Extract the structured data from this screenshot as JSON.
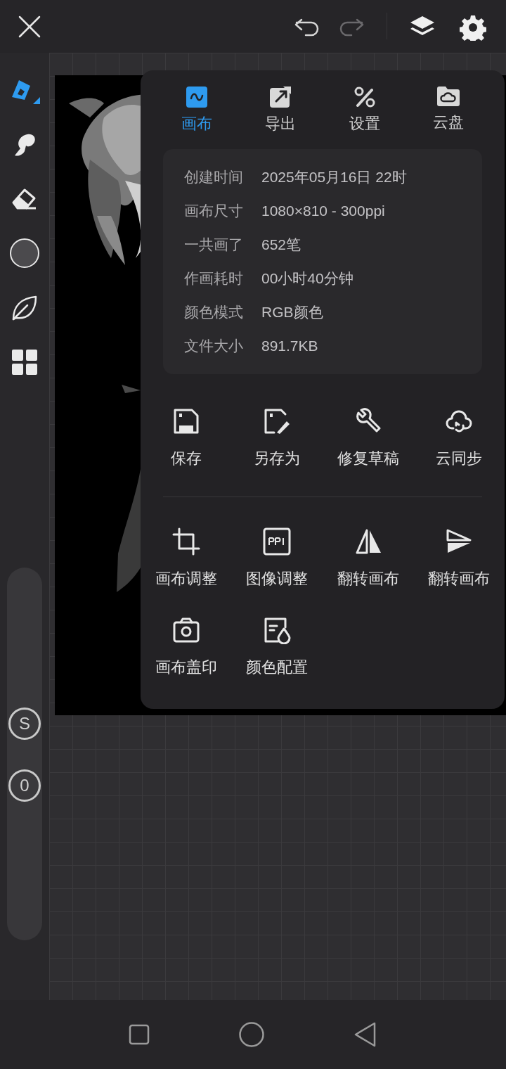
{
  "top_bar": {
    "redo_disabled": true
  },
  "toolbar": {
    "tools": [
      {
        "kind": "pen",
        "selected": true
      },
      {
        "kind": "smudge",
        "selected": false
      },
      {
        "kind": "eraser",
        "selected": false
      },
      {
        "kind": "color",
        "selected": false,
        "color": "#4b4a4d"
      },
      {
        "kind": "leaf",
        "selected": false
      },
      {
        "kind": "grid",
        "selected": false
      }
    ],
    "sliders": [
      {
        "label": "S",
        "level": 0.09
      },
      {
        "label": "0",
        "level": 0.9
      }
    ]
  },
  "panel": {
    "tabs": [
      {
        "label": "画布",
        "selected": true
      },
      {
        "label": "导出",
        "selected": false
      },
      {
        "label": "设置",
        "selected": false
      },
      {
        "label": "云盘",
        "selected": false
      }
    ],
    "info": [
      {
        "label": "创建时间",
        "value": "2025年05月16日 22时"
      },
      {
        "label": "画布尺寸",
        "value": "1080×810 - 300ppi"
      },
      {
        "label": "一共画了",
        "value": "652笔"
      },
      {
        "label": "作画耗时",
        "value": "00小时40分钟"
      },
      {
        "label": "颜色模式",
        "value": "RGB颜色"
      },
      {
        "label": "文件大小",
        "value": "891.7KB"
      }
    ],
    "file_actions": [
      "保存",
      "另存为",
      "修复草稿",
      "云同步"
    ],
    "canvas_actions": [
      "画布调整",
      "图像调整",
      "翻转画布",
      "翻转画布",
      "画布盖印",
      "颜色配置"
    ]
  }
}
